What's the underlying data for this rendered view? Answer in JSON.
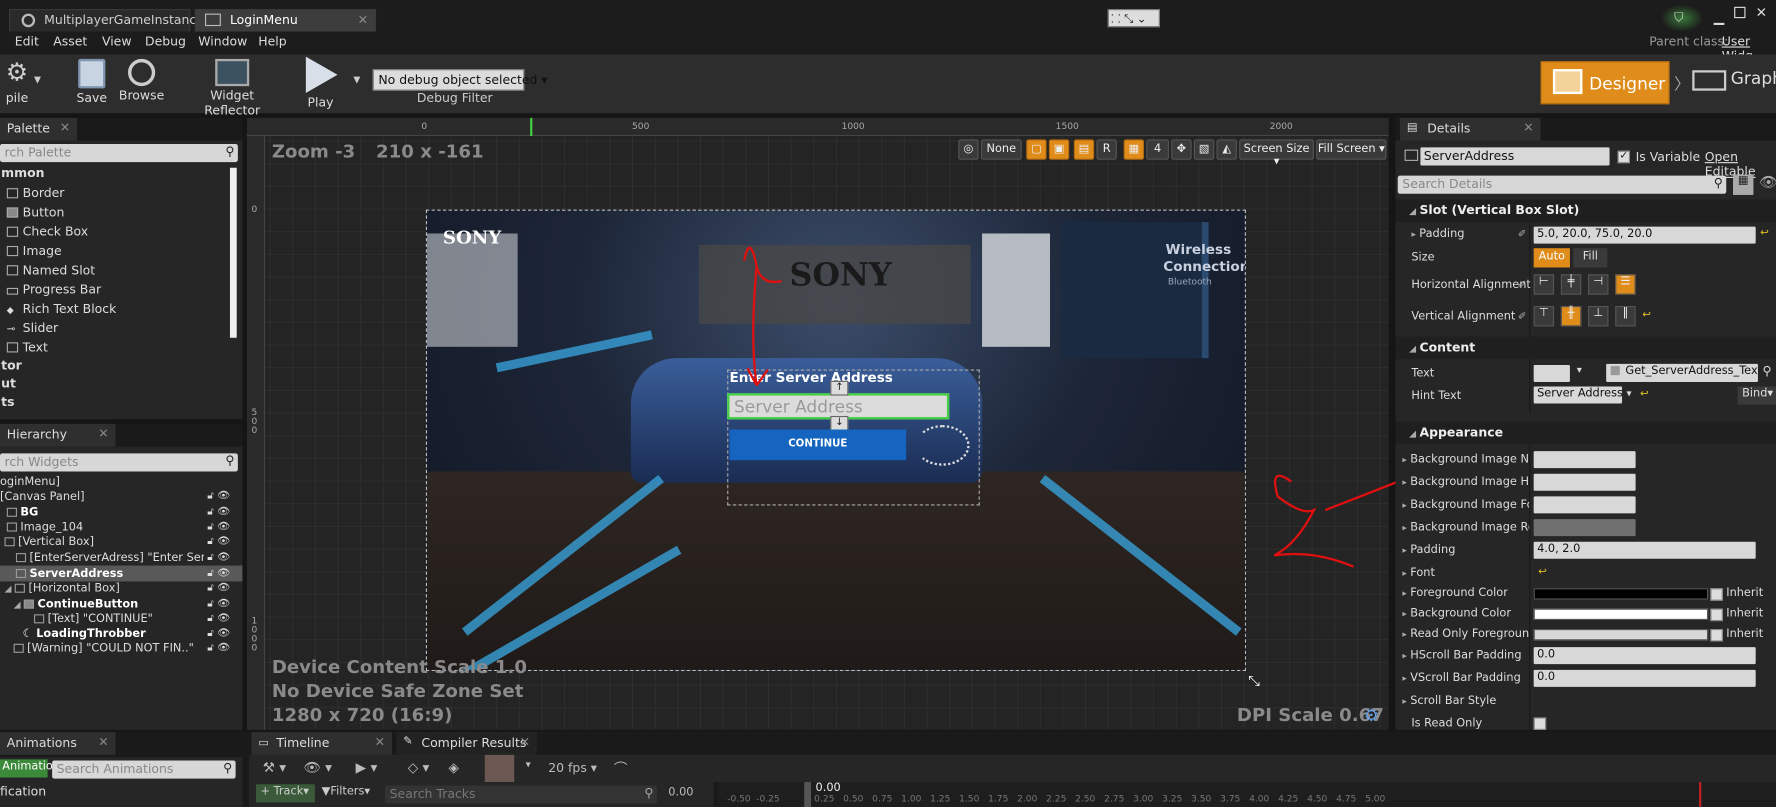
{
  "tabs": [
    {
      "label": "MultiplayerGameInstance"
    },
    {
      "label": "LoginMenu"
    }
  ],
  "parent_class": {
    "label": "Parent class:",
    "value": "User Widg"
  },
  "menu": [
    "Edit",
    "Asset",
    "View",
    "Debug",
    "Window",
    "Help"
  ],
  "toolbar": {
    "compile": "pile",
    "save": "Save",
    "browse": "Browse",
    "reflector": "Widget Reflector",
    "play": "Play",
    "debug_select": "No debug object selected",
    "debug_filter": "Debug Filter",
    "designer": "Designer",
    "graph": "Graph"
  },
  "palette": {
    "tab": "Palette",
    "search": "rch Palette",
    "category_common": "mmon",
    "items": [
      "Border",
      "Button",
      "Check Box",
      "Image",
      "Named Slot",
      "Progress Bar",
      "Rich Text Block",
      "Slider",
      "Text"
    ],
    "categories_more": [
      "tor",
      "ut",
      "ts"
    ]
  },
  "hierarchy": {
    "tab": "Hierarchy",
    "search": "rch Widgets",
    "rows": [
      "oginMenu]",
      "[Canvas Panel]",
      "BG",
      "Image_104",
      "[Vertical Box]",
      "[EnterServerAdress] \"Enter Server ..",
      "ServerAddress",
      "[Horizontal Box]",
      "ContinueButton",
      "[Text] \"CONTINUE\"",
      "LoadingThrobber",
      "[Warning] \"COULD NOT FIN..\""
    ]
  },
  "viewport": {
    "zoom": "Zoom -3",
    "size": "210 x -161",
    "device_scale": "Device Content Scale 1.0",
    "safe_zone": "No Device Safe Zone Set",
    "resolution": "1280 x 720 (16:9)",
    "dpi": "DPI Scale 0.67",
    "ruler_top": [
      "0",
      "500",
      "1000",
      "1500",
      "2000"
    ],
    "ruler_left": [
      "0",
      "5 0 0",
      "1 0 0 0"
    ],
    "buttons": {
      "none": "None",
      "r": "R",
      "four": "4",
      "screen_size": "Screen Size",
      "fill_screen": "Fill Screen"
    }
  },
  "widget": {
    "sony_logo": "SONY",
    "wall_sign": "SONY",
    "wireless": "Wireless",
    "connection": "Connection",
    "bluetooth": "Bluetooth",
    "enter_server": "Enter Server Address",
    "server_placeholder": "Server Address",
    "continue": "CONTINUE"
  },
  "details": {
    "tab": "Details",
    "name": "ServerAddress",
    "is_variable": "Is Variable",
    "open_editable": "Open Editable",
    "search": "Search Details",
    "slot_section": "Slot (Vertical Box Slot)",
    "padding_label": "Padding",
    "padding_value": "5.0, 20.0, 75.0, 20.0",
    "size_label": "Size",
    "size_auto": "Auto",
    "size_fill": "Fill",
    "h_align": "Horizontal Alignment",
    "v_align": "Vertical Alignment",
    "content_section": "Content",
    "text_label": "Text",
    "text_binding": "Get_ServerAddress_Text",
    "hint_label": "Hint Text",
    "hint_value": "Server Address",
    "bind": "Bind",
    "appearance_section": "Appearance",
    "bg_rows": [
      "Background Image Norm",
      "Background Image Hove",
      "Background Image Focu",
      "Background Image Read"
    ],
    "padding2_label": "Padding",
    "padding2_value": "4.0, 2.0",
    "font": "Font",
    "fg_color": "Foreground Color",
    "bg_color": "Background Color",
    "ro_fg": "Read Only Foreground C",
    "inherit": "Inherit",
    "hscroll": "HScroll Bar Padding",
    "hscroll_value": "0.0",
    "vscroll": "VScroll Bar Padding",
    "vscroll_value": "0.0",
    "scroll_style": "Scroll Bar Style",
    "read_only": "Is Read Only"
  },
  "bottom": {
    "animations_tab": "Animations",
    "animation_btn": "Animation",
    "search_anim": "Search Animations",
    "notification": "fication",
    "timeline_tab": "Timeline",
    "compiler_tab": "Compiler Results",
    "fps": "20 fps",
    "track": "Track",
    "filters": "Filters",
    "search_tracks": "Search Tracks",
    "time": "0.00",
    "time2": "0.00",
    "ticks": [
      "-0.50",
      "-0.25",
      "0.25",
      "0.50",
      "0.75",
      "1.00",
      "1.25",
      "1.50",
      "1.75",
      "2.00",
      "2.25",
      "2.50",
      "2.75",
      "3.00",
      "3.25",
      "3.50",
      "3.75",
      "4.00",
      "4.25",
      "4.50",
      "4.75",
      "5.00"
    ]
  },
  "colors": {
    "accent": "#e08c1a",
    "annotation": "#e01010",
    "selection": "#3fcf3f",
    "button_blue": "#1565c0"
  }
}
